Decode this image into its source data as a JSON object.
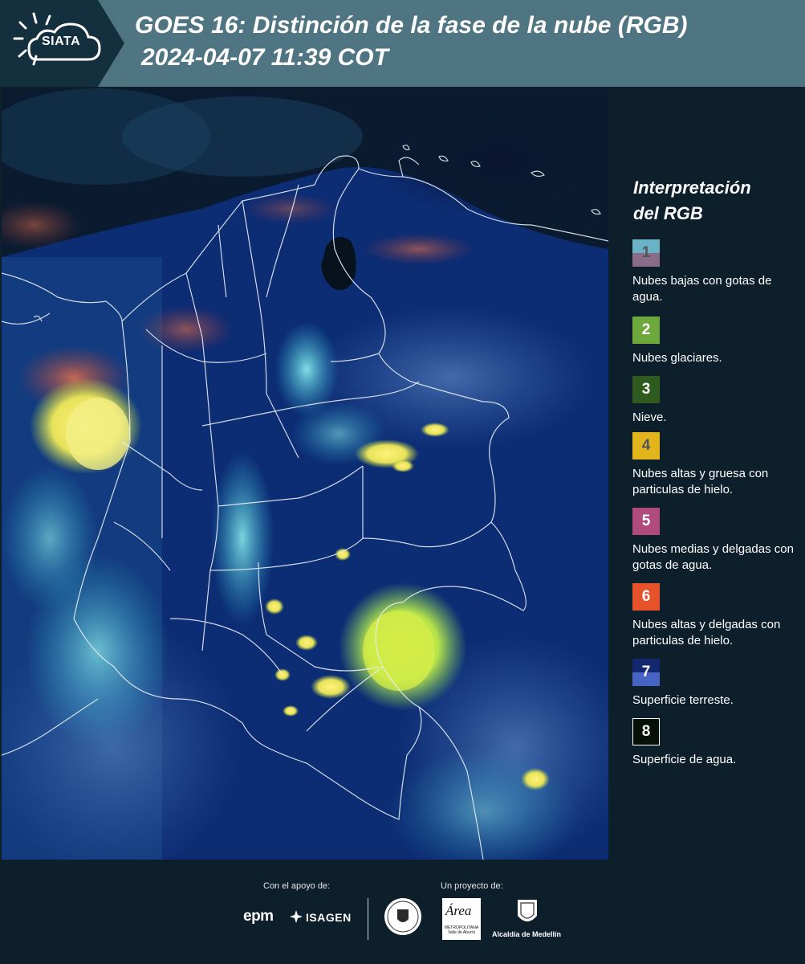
{
  "header": {
    "logo_text": "SIATA",
    "title": "GOES 16: Distinción de la fase de la nube (RGB)",
    "subtitle": "2024-04-07 11:39 COT",
    "background": "#4f7482"
  },
  "legend": {
    "title_line1": "Interpretación",
    "title_line2": "del RGB",
    "items": [
      {
        "number": "1",
        "label": "Nubes bajas con gotas de agua.",
        "color_top": "#6ab3c6",
        "color_bottom": "#8a6c8a",
        "text_color": "#555555"
      },
      {
        "number": "2",
        "label": "Nubes glaciares.",
        "color_top": "#6ea83c",
        "color_bottom": "#6ea83c",
        "text_color": "#ffffff"
      },
      {
        "number": "3",
        "label": "Nieve.",
        "color_top": "#2f5b1e",
        "color_bottom": "#2f5b1e",
        "text_color": "#ffffff"
      },
      {
        "number": "4",
        "label": "Nubes altas y gruesa con particulas de hielo.",
        "color_top": "#e3b51c",
        "color_bottom": "#e3b51c",
        "text_color": "#555555"
      },
      {
        "number": "5",
        "label": "Nubes medias y delgadas con gotas de agua.",
        "color_top": "#b04c7c",
        "color_bottom": "#b04c7c",
        "text_color": "#ffffff"
      },
      {
        "number": "6",
        "label": "Nubes altas y delgadas con particulas de hielo.",
        "color_top": "#e6522a",
        "color_bottom": "#e6522a",
        "text_color": "#ffffff"
      },
      {
        "number": "7",
        "label": "Superficie terreste.",
        "color_top": "#13276e",
        "color_bottom": "#4763c4",
        "text_color": "#ffffff"
      },
      {
        "number": "8",
        "label": "Superficie de agua.",
        "color_top": "#061008",
        "color_bottom": "#061008",
        "text_color": "#ffffff"
      }
    ]
  },
  "footer": {
    "support_label": "Con el apoyo de:",
    "project_label": "Un proyecto de:",
    "sponsor_1": "epm",
    "sponsor_2": "ISAGEN",
    "partner_1_text": "Área",
    "partner_1_sub": "METROPOLITANA Valle de Aburrá",
    "partner_2": "Alcaldía de Medellín"
  }
}
